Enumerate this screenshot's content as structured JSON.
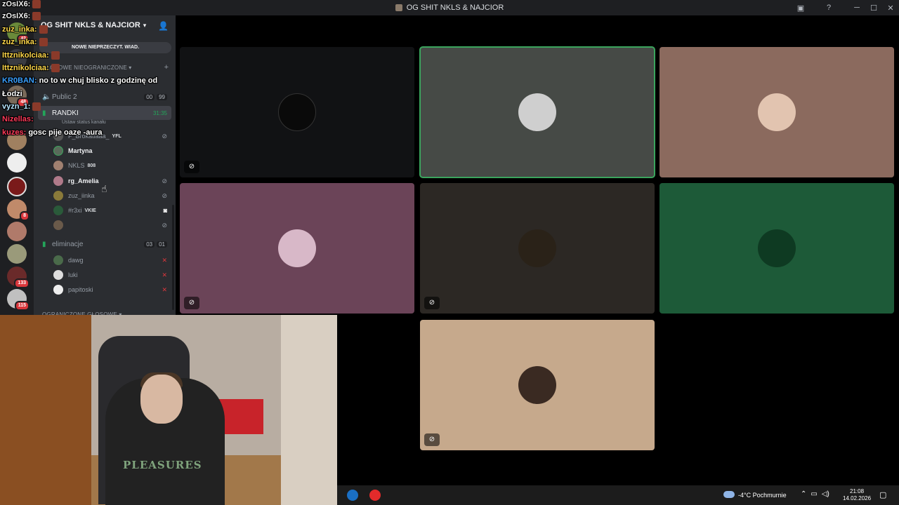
{
  "window": {
    "title": "OG SHIT NKLS & NAJCIOR"
  },
  "server": {
    "name": "OG SHIT NKLS & NAJCIOR",
    "new_banner": "NOWE NIEPRZECZYT. WIAD.",
    "rail_badges": [
      "43",
      "48",
      "8",
      "133",
      "115"
    ]
  },
  "sidebar": {
    "category_1": "GŁOSOWE NIEOGRANICZONE",
    "category_2": "OGRANICZONE GŁOSOWE",
    "channels": {
      "public2": {
        "name": "Public 2",
        "count_a": "00",
        "count_b": "99"
      },
      "randki": {
        "name": "RANDKI",
        "timer": "31:35",
        "status": "Ustaw status kanału"
      },
      "eliminacje": {
        "name": "eliminacje",
        "count_a": "03",
        "count_b": "01"
      }
    },
    "randki_users": [
      {
        "name": "F_Brokatiaaa_",
        "tag": "YFL"
      },
      {
        "name": "Martyna"
      },
      {
        "name": "NKLS",
        "tag": "808"
      },
      {
        "name": "rg_Amelia"
      },
      {
        "name": "zuz_iinka"
      },
      {
        "name": "#r3xi",
        "tag": "VKIE"
      },
      {
        "name": ""
      }
    ],
    "elim_users": [
      {
        "name": "dawg"
      },
      {
        "name": "luki"
      },
      {
        "name": "papitoski"
      }
    ]
  },
  "chat": [
    {
      "user": "zOsIX6:",
      "color": "#f0f0f0",
      "msg": ""
    },
    {
      "user": "zOsIX6:",
      "color": "#f0f0f0",
      "msg": ""
    },
    {
      "user": "zuz_inka:",
      "color": "#ffd84a",
      "msg": ""
    },
    {
      "user": "zuz_inka:",
      "color": "#ffd84a",
      "msg": ""
    },
    {
      "user": "Ittznikolciaa:",
      "color": "#ffd84a",
      "msg": ""
    },
    {
      "user": "Ittznikolciaa:",
      "color": "#ffd84a",
      "msg": ""
    },
    {
      "user": "KR0BAN:",
      "color": "#3aa0ff",
      "msg": "no to w chuj blisko z godzinę od"
    },
    {
      "user": "",
      "color": "#ffffff",
      "msg": "Łodzi"
    },
    {
      "user": "vyzn_1:",
      "color": "#b7e6ff",
      "msg": ""
    },
    {
      "user": "Nizellas:",
      "color": "#ff3a5a",
      "msg": ""
    },
    {
      "user": "kuzes:",
      "color": "#ff3a5a",
      "msg": "gosc pije oaze -aura"
    }
  ],
  "grid": {
    "tiles": [
      {
        "bg": "#111214",
        "muted": true
      },
      {
        "bg": "#464a46",
        "muted": false
      },
      {
        "bg": "#8b6a5e",
        "muted": false
      },
      {
        "bg": "#6b4458",
        "muted": true
      },
      {
        "bg": "#2c2824",
        "muted": true
      },
      {
        "bg": "#1d5a38",
        "muted": false
      },
      {
        "bg": "#c6a98c",
        "muted": true
      }
    ]
  },
  "taskbar": {
    "weather": "-4°C  Pochmurnie",
    "time": "21:08",
    "date": "14.02.2026"
  },
  "colors": {
    "speaking": "#3ba55d",
    "accent": "#5865f2",
    "danger": "#da373c"
  }
}
